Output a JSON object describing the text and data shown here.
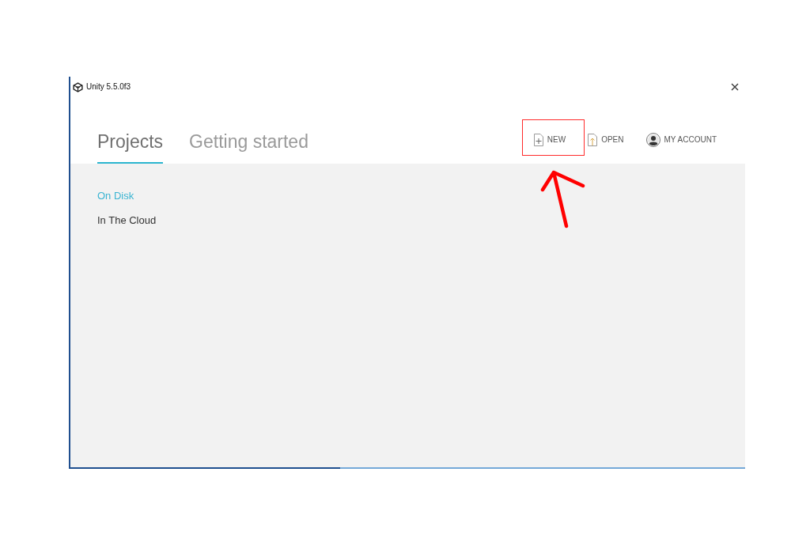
{
  "window": {
    "title": "Unity 5.5.0f3"
  },
  "tabs": [
    {
      "label": "Projects",
      "selected": true
    },
    {
      "label": "Getting started",
      "selected": false
    }
  ],
  "actions": [
    {
      "kind": "new",
      "label": "NEW"
    },
    {
      "kind": "open",
      "label": "OPEN"
    },
    {
      "kind": "account",
      "label": "MY ACCOUNT"
    }
  ],
  "sidebar": {
    "items": [
      {
        "label": "On Disk",
        "selected": true
      },
      {
        "label": "In The Cloud",
        "selected": false
      }
    ]
  },
  "progress": {
    "level": 0.4
  }
}
